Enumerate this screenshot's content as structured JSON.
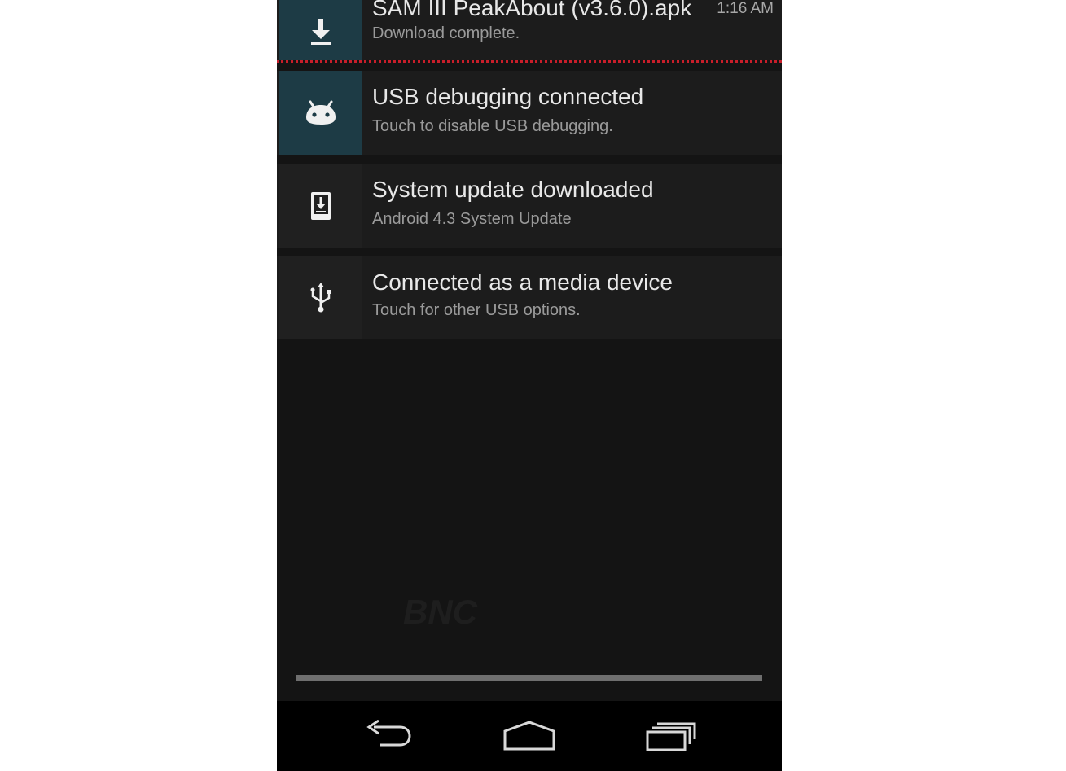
{
  "notifications": [
    {
      "title": "SAM III PeakAbout (v3.6.0).apk",
      "subtitle": "Download complete.",
      "time": "1:16 AM",
      "icon": "download-icon"
    },
    {
      "title": "USB debugging connected",
      "subtitle": "Touch to disable USB debugging.",
      "icon": "android-icon"
    },
    {
      "title": "System update downloaded",
      "subtitle": "Android 4.3 System Update",
      "icon": "system-update-icon"
    },
    {
      "title": "Connected as a media device",
      "subtitle": "Touch for other USB options.",
      "icon": "usb-icon"
    }
  ],
  "watermark": "BNC",
  "navbar": {
    "back": "back-icon",
    "home": "home-icon",
    "recents": "recents-icon"
  },
  "colors": {
    "accent_teal": "#1d3b45",
    "divider_red": "#c81e2a",
    "background": "#141414"
  }
}
